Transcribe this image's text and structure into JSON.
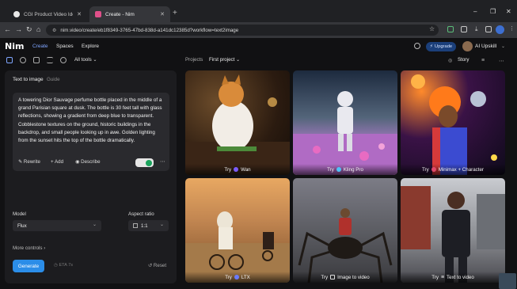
{
  "browser": {
    "tabs": [
      {
        "title": "CGI Product Video Ideas",
        "active": false,
        "color": "#e8e8e8"
      },
      {
        "title": "Create - Nim",
        "active": true,
        "color": "#e0508a"
      }
    ],
    "new_tab": "+",
    "url": "nim.video/create/eb1f8349-3765-47bd-838d-a141dc12385d?workflow=text2image"
  },
  "app": {
    "logo": "Nim",
    "nav": [
      {
        "label": "Create",
        "active": true
      },
      {
        "label": "Spaces",
        "active": false
      },
      {
        "label": "Explore",
        "active": false
      }
    ],
    "upgrade_label": "Upgrade",
    "user_name": "AI Upskill",
    "all_tools_label": "All tools",
    "projects_label": "Projects",
    "project_name": "First project",
    "story_label": "Story"
  },
  "panel": {
    "title": "Text to image",
    "guide": "Guide",
    "prompt": "A towering Dior Sauvage perfume bottle placed in the middle of a grand Parisian square at dusk. The bottle is 30 feet tall with glass reflections, showing a gradient from deep blue to transparent. Cobblestone textures on the ground, historic buildings in the backdrop, and small people looking up in awe. Golden lighting from the sunset hits the top of the bottle dramatically.",
    "actions": {
      "rewrite": "Rewrite",
      "add": "Add",
      "describe": "Describe"
    },
    "model_label": "Model",
    "model_value": "Flux",
    "aspect_label": "Aspect ratio",
    "aspect_value": "1:1",
    "more_controls": "More controls",
    "generate": "Generate",
    "eta": "ETA 7s",
    "reset": "Reset"
  },
  "gallery": [
    {
      "try": "Try",
      "model": "Wan",
      "icon_color": "#7b5cff"
    },
    {
      "try": "Try",
      "model": "Kling Pro",
      "icon_color": "#4fc3f7"
    },
    {
      "try": "Try",
      "model": "Minimax + Character",
      "icon_color": "#e24a6a"
    },
    {
      "try": "Try",
      "model": "LTX",
      "icon_color": "#6a7bff"
    },
    {
      "try": "Try",
      "model": "Image to video",
      "icon_color": "#dddddd"
    },
    {
      "try": "Try",
      "model": "Text to video",
      "icon_color": "#dddddd"
    }
  ]
}
